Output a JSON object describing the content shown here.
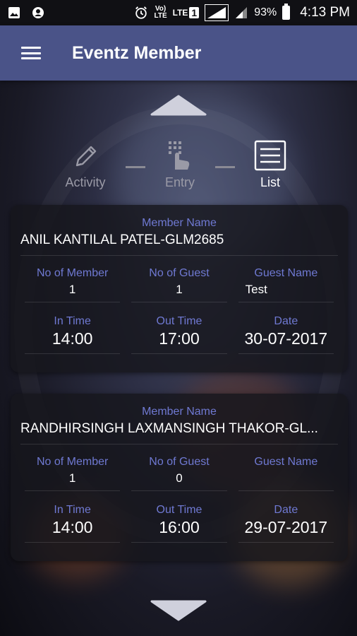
{
  "status_bar": {
    "left_icons": [
      "image-icon",
      "account-circle-icon"
    ],
    "alarm_icon": "alarm-icon",
    "volte_label": "Vo)\nLTE",
    "lte_label": "LTE",
    "sim_label": "1",
    "battery_percent": "93%",
    "time": "4:13 PM"
  },
  "app_bar": {
    "title": "Eventz Member",
    "menu_icon": "hamburger-menu-icon"
  },
  "tabs": [
    {
      "label": "Activity",
      "icon": "pencil-icon",
      "active": false
    },
    {
      "label": "Entry",
      "icon": "keypad-touch-icon",
      "active": false
    },
    {
      "label": "List",
      "icon": "list-icon",
      "active": true
    }
  ],
  "labels": {
    "member_name": "Member Name",
    "no_of_member": "No of Member",
    "no_of_guest": "No of Guest",
    "guest_name": "Guest Name",
    "in_time": "In Time",
    "out_time": "Out Time",
    "date": "Date"
  },
  "records": [
    {
      "member_name": "ANIL KANTILAL PATEL-GLM2685",
      "no_of_member": "1",
      "no_of_guest": "1",
      "guest_name": "Test",
      "in_time": "14:00",
      "out_time": "17:00",
      "date": "30-07-2017"
    },
    {
      "member_name": "RANDHIRSINGH LAXMANSINGH THAKOR-GL...",
      "no_of_member": "1",
      "no_of_guest": "0",
      "guest_name": "",
      "in_time": "14:00",
      "out_time": "16:00",
      "date": "29-07-2017"
    }
  ],
  "colors": {
    "app_bar": "#4a5388",
    "label_accent": "#6f79d2"
  }
}
